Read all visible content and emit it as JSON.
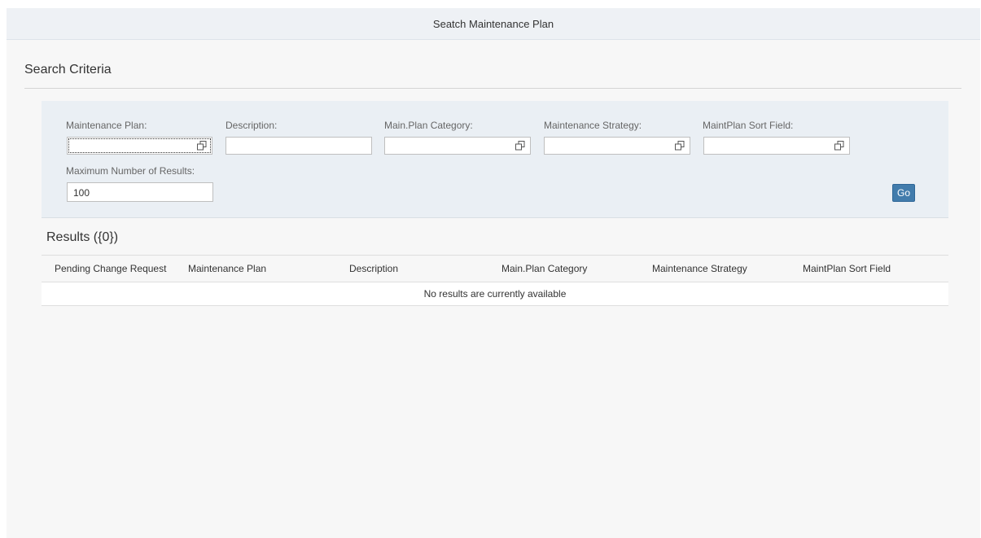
{
  "page": {
    "title": "Seatch Maintenance Plan"
  },
  "search_criteria": {
    "title": "Search Criteria",
    "fields": [
      {
        "label": "Maintenance Plan:",
        "value": "",
        "icon": "value-help-icon"
      },
      {
        "label": "Description:",
        "value": ""
      },
      {
        "label": "Main.Plan Category:",
        "value": "",
        "icon": "value-help-icon"
      },
      {
        "label": "Maintenance Strategy:",
        "value": "",
        "icon": "value-help-icon"
      },
      {
        "label": "MaintPlan Sort Field:",
        "value": "",
        "icon": "value-help-icon"
      }
    ],
    "max_results": {
      "label": "Maximum Number of Results:",
      "value": "100"
    },
    "go_label": "Go"
  },
  "results": {
    "title": "Results ({0})",
    "columns": [
      "Pending Change Request",
      "Maintenance Plan",
      "Description",
      "Main.Plan Category",
      "Maintenance Strategy",
      "MaintPlan Sort Field"
    ],
    "no_data_text": "No results are currently available"
  },
  "colors": {
    "accent": "#427cac",
    "filter_bar_bg": "#eaeff4",
    "title_bar_bg": "#eef1f5"
  }
}
